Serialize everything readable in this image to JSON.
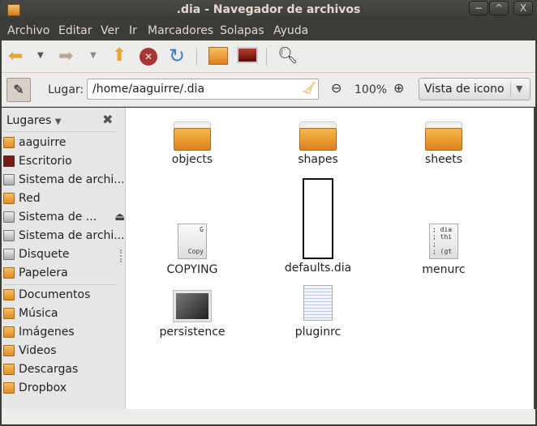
{
  "window": {
    "title": ".dia - Navegador de archivos",
    "controls": [
      "−",
      "^",
      "X"
    ]
  },
  "menu": [
    "Archivo",
    "Editar",
    "Ver",
    "Ir",
    "Marcadores",
    "Solapas",
    "Ayuda"
  ],
  "toolbar": {
    "icons": [
      "back-icon",
      "forward-icon",
      "up-icon",
      "stop-icon",
      "reload-icon",
      "home-icon",
      "computer-icon",
      "search-icon"
    ]
  },
  "location": {
    "label": "Lugar:",
    "path": "/home/aaguirre/.dia",
    "zoom": "100%",
    "view": "Vista de icono"
  },
  "sidebar": {
    "title": "Lugares",
    "items": [
      {
        "label": "aaguirre",
        "icon": "home-folder"
      },
      {
        "label": "Escritorio",
        "icon": "desktop"
      },
      {
        "label": "Sistema de archi...",
        "icon": "drive"
      },
      {
        "label": "Red",
        "icon": "network"
      },
      {
        "label": "Sistema de ...",
        "icon": "drive",
        "eject": true
      },
      {
        "label": "Sistema de archi...",
        "icon": "drive"
      },
      {
        "label": "Disquete",
        "icon": "floppy"
      },
      {
        "label": "Papelera",
        "icon": "trash"
      }
    ],
    "bookmarks": [
      {
        "label": "Documentos"
      },
      {
        "label": "Música"
      },
      {
        "label": "Imágenes"
      },
      {
        "label": "Videos"
      },
      {
        "label": "Descargas"
      },
      {
        "label": "Dropbox"
      }
    ]
  },
  "files": [
    {
      "name": "objects",
      "type": "folder"
    },
    {
      "name": "shapes",
      "type": "folder"
    },
    {
      "name": "sheets",
      "type": "folder"
    },
    {
      "name": "COPYING",
      "type": "text",
      "preview": "G\n\n\nCopy"
    },
    {
      "name": "defaults.dia",
      "type": "dia"
    },
    {
      "name": "menurc",
      "type": "text",
      "preview": "; dia\n; thi\n;\n; (gt"
    },
    {
      "name": "persistence",
      "type": "image"
    },
    {
      "name": "pluginrc",
      "type": "text"
    }
  ]
}
